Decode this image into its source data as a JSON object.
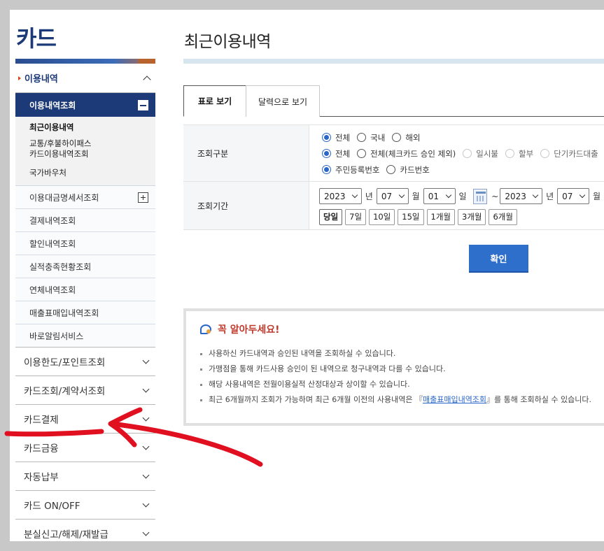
{
  "sidebar": {
    "title": "카드",
    "section": "이용내역",
    "active_sub": "이용내역조회",
    "sub_items": [
      "최근이용내역",
      "교통/후불하이패스\n카드이용내역조회",
      "국가바우처"
    ],
    "items": [
      "이용대금명세서조회",
      "결제내역조회",
      "할인내역조회",
      "실적충족현황조회",
      "연체내역조회",
      "매출표매입내역조회",
      "바로알림서비스"
    ],
    "menus": [
      "이용한도/포인트조회",
      "카드조회/계약서조회",
      "카드결제",
      "카드금융",
      "자동납부",
      "카드 ON/OFF",
      "분실신고/해제/재발급"
    ]
  },
  "main": {
    "title": "최근이용내역",
    "tabs": [
      "표로 보기",
      "달력으로 보기"
    ],
    "form": {
      "row1_label": "조회구분",
      "row1_line1": [
        "전체",
        "국내",
        "해외"
      ],
      "row1_line2": [
        "전체",
        "전체(체크카드 승인 제외)",
        "일시불",
        "할부",
        "단기카드대출"
      ],
      "row1_line3": [
        "주민등록번호",
        "카드번호"
      ],
      "row2_label": "조회기간",
      "start_year": "2023",
      "start_month": "07",
      "start_day": "01",
      "end_year": "2023",
      "end_month": "07",
      "unit_year": "년",
      "unit_month": "월",
      "unit_day": "일",
      "tilde": "~",
      "periods": [
        "당일",
        "7일",
        "10일",
        "15일",
        "1개월",
        "3개월",
        "6개월"
      ]
    },
    "confirm": "확인",
    "notice": {
      "title": "꼭 알아두세요!",
      "lines": [
        "사용하신 카드내역과 승인된 내역을 조회하실 수 있습니다.",
        "가맹점을 통해 카드사용 승인이 된 내역으로 청구내역과 다를 수 있습니다.",
        "해당 사용내역은 전월이용실적 산정대상과 상이할 수 있습니다."
      ],
      "last_pre": "최근 6개월까지 조회가 가능하며 최근 6개월 이전의 사용내역은 『",
      "last_link": "매출표매입내역조회",
      "last_post": "』를 통해 조회하실 수 있습니다."
    }
  },
  "colors": {
    "brand": "#1d3a78",
    "accent": "#2f6fcc",
    "annotation": "#e01020"
  }
}
